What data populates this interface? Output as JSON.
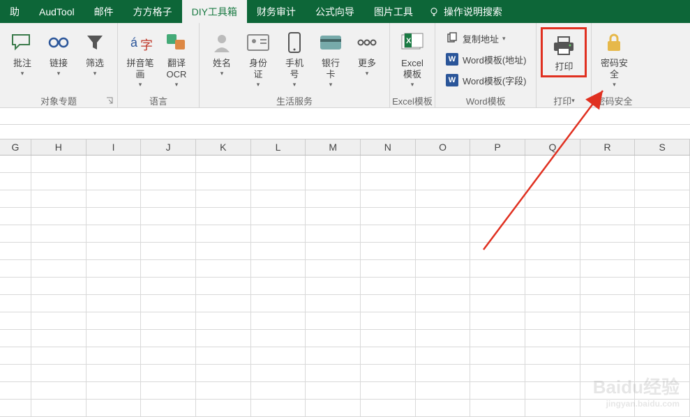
{
  "tabs": {
    "t0": "助",
    "t1": "AudTool",
    "t2": "邮件",
    "t3": "方方格子",
    "t4": "DIY工具箱",
    "t5": "财务审计",
    "t6": "公式向导",
    "t7": "图片工具",
    "help": "操作说明搜索"
  },
  "groups": {
    "object": {
      "label": "对象专题",
      "btns": {
        "annotate": "批注",
        "link": "链接",
        "filter": "筛选"
      }
    },
    "language": {
      "label": "语言",
      "btns": {
        "pinyin": "拼音笔\n画",
        "ocr": "翻译\nOCR"
      }
    },
    "life": {
      "label": "生活服务",
      "btns": {
        "name": "姓名",
        "idcard": "身份\n证",
        "phone": "手机\n号",
        "bank": "银行\n卡",
        "more": "更多"
      }
    },
    "excel": {
      "label": "Excel模板",
      "btns": {
        "tpl": "Excel\n模板"
      }
    },
    "word": {
      "label": "Word模板",
      "btns": {
        "copy": "复制地址",
        "addr": "Word模板(地址)",
        "field": "Word模板(字段)"
      }
    },
    "print": {
      "label": "打印",
      "btn": "打印"
    },
    "security": {
      "label": "密码安全",
      "btn": "密码安\n全"
    }
  },
  "columns": [
    "G",
    "H",
    "I",
    "J",
    "K",
    "L",
    "M",
    "N",
    "O",
    "P",
    "Q",
    "R",
    "S"
  ],
  "colors": {
    "primary": "#0d6638",
    "highlight": "#e03020"
  },
  "watermark": {
    "main": "Baidu经验",
    "sub": "jingyan.baidu.com"
  }
}
